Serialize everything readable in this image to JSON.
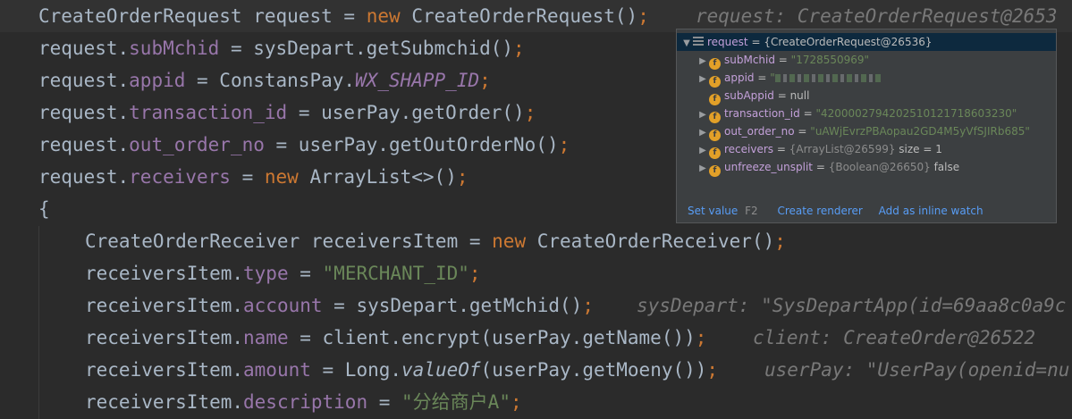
{
  "code": {
    "line1": {
      "type": "CreateOrderRequest",
      "var": "request",
      "eq": "=",
      "kw": "new",
      "ctor": "CreateOrderRequest()",
      "semi": ";",
      "hint": "request: CreateOrderRequest@2653"
    },
    "line2": {
      "obj": "request.",
      "field": "subMchid",
      "rest": " = sysDepart.getSubmchid()",
      "semi": ";"
    },
    "line3": {
      "obj": "request.",
      "field": "appid",
      "rest": " = ConstansPay.",
      "static_field": "WX_SHAPP_ID",
      "semi": ";"
    },
    "line4": {
      "obj": "request.",
      "field": "transaction_id",
      "rest": " = userPay.getOrder()",
      "semi": ";"
    },
    "line5": {
      "obj": "request.",
      "field": "out_order_no",
      "rest": " = userPay.getOutOrderNo()",
      "semi": ";"
    },
    "line6": {
      "obj": "request.",
      "field": "receivers",
      "eq": " = ",
      "kw": "new",
      "rest": " ArrayList<>()",
      "semi": ";"
    },
    "line7": {
      "text": "{"
    },
    "line8": {
      "type": "CreateOrderReceiver receiversItem = ",
      "kw": "new",
      "rest": " CreateOrderReceiver()",
      "semi": ";"
    },
    "line9": {
      "obj": "receiversItem.",
      "field": "type",
      "eq": " = ",
      "str": "\"MERCHANT_ID\"",
      "semi": ";"
    },
    "line10": {
      "obj": "receiversItem.",
      "field": "account",
      "rest": " = sysDepart.getMchid()",
      "semi": ";",
      "hint": "sysDepart: \"SysDepartApp(id=69aa8c0a9c"
    },
    "line11": {
      "obj": "receiversItem.",
      "field": "name",
      "rest": " = client.encrypt(userPay.getName())",
      "semi": ";",
      "hint": "client: CreateOrder@26522"
    },
    "line12": {
      "obj": "receiversItem.",
      "field": "amount",
      "rest1": " = Long.",
      "method": "valueOf",
      "rest2": "(userPay.getMoeny())",
      "semi": ";",
      "hint": "userPay: \"UserPay(openid=nu"
    },
    "line13": {
      "obj": "receiversItem.",
      "field": "description",
      "eq": " = ",
      "str": "\"分给商户A\"",
      "semi": ";"
    }
  },
  "popup": {
    "root": {
      "name": "request",
      "value": "= {CreateOrderRequest@26536}"
    },
    "fields": [
      {
        "name": "subMchid",
        "eq": " = ",
        "value": "\"1728550969\"",
        "kind": "str",
        "expandable": true
      },
      {
        "name": "appid",
        "eq": " = ",
        "value": "\"",
        "kind": "masked",
        "expandable": true
      },
      {
        "name": "subAppid",
        "eq": " = ",
        "value": "null",
        "kind": "plain",
        "expandable": false
      },
      {
        "name": "transaction_id",
        "eq": " = ",
        "value": "\"4200002794202510121718603230\"",
        "kind": "str",
        "expandable": true
      },
      {
        "name": "out_order_no",
        "eq": " = ",
        "value": "\"uAWjEvrzPBAopau2GD4M5yVfSJIRb685\"",
        "kind": "str",
        "expandable": true
      },
      {
        "name": "receivers",
        "eq": " = ",
        "value": "{ArrayList@26599}",
        "extra": " size = 1",
        "kind": "ref",
        "expandable": true
      },
      {
        "name": "unfreeze_unsplit",
        "eq": " = ",
        "value": "{Boolean@26650}",
        "extra": " false",
        "kind": "ref",
        "expandable": true
      }
    ],
    "footer": {
      "set_value": "Set value",
      "set_value_shortcut": "F2",
      "create_renderer": "Create renderer",
      "add_inline_watch": "Add as inline watch"
    },
    "field_icon_letter": "f"
  }
}
